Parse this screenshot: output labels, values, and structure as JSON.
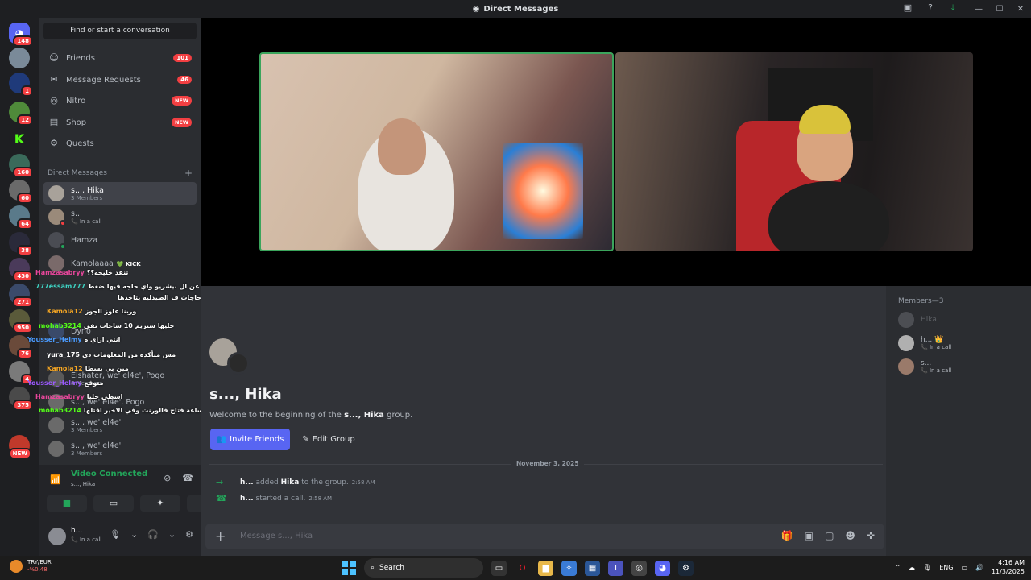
{
  "window": {
    "title": "Direct Messages",
    "controls": [
      "—",
      "☐",
      "✕"
    ]
  },
  "servers": [
    {
      "badge": "148"
    },
    {
      "badge": ""
    },
    {
      "badge": "1"
    },
    {
      "badge": "12"
    },
    {
      "badge": ""
    },
    {
      "badge": "160"
    },
    {
      "badge": "60"
    },
    {
      "badge": "64"
    },
    {
      "badge": "38"
    },
    {
      "badge": "430"
    },
    {
      "badge": "271"
    },
    {
      "badge": "950"
    },
    {
      "badge": "76"
    },
    {
      "badge": "4"
    },
    {
      "badge": "375"
    },
    {
      "badge": "NEW"
    }
  ],
  "sidebar": {
    "find_button": "Find or start a conversation",
    "nav": [
      {
        "label": "Friends",
        "icon": "friends-icon",
        "count": "101"
      },
      {
        "label": "Message Requests",
        "icon": "mail-icon",
        "count": "46"
      },
      {
        "label": "Nitro",
        "icon": "nitro-icon",
        "new": "NEW"
      },
      {
        "label": "Shop",
        "icon": "shop-icon",
        "new": "NEW"
      },
      {
        "label": "Quests",
        "icon": "quests-icon"
      }
    ],
    "dm_header": "Direct Messages",
    "dms": [
      {
        "name": "s..., Hika",
        "sub": "3 Members"
      },
      {
        "name": "s...",
        "sub": "In a call"
      },
      {
        "name": "Hamza",
        "sub": ""
      },
      {
        "name": "Kamolaaaa",
        "sub": "",
        "badge": "KICK"
      },
      {
        "name": "Dyno",
        "sub": ""
      },
      {
        "name": "Elshater, we' el4e', Pogo",
        "sub": "4 Members"
      },
      {
        "name": "s..., we' el4e', Pogo",
        "sub": ""
      },
      {
        "name": "s..., we' el4e'",
        "sub": "3 Members"
      },
      {
        "name": "s..., we' el4e'",
        "sub": "3 Members"
      }
    ]
  },
  "chat_overlay": [
    {
      "user": "Hamzasabryy",
      "msg": "تنفذ خليجه؟؟",
      "color": "#e8469b"
    },
    {
      "user": "777essam777",
      "msg": "لو عايز تبطل بجد العب رياضه وابعد عن ال بيشريو واي حاجه فيها ضغط",
      "color": "#3ed4c4"
    },
    {
      "user": "",
      "msg": "وف حاجات ف الصيدليه بتاخدها",
      "color": "#ffffff"
    },
    {
      "user": "Kamola12",
      "msg": "وربنا عاوز الجوز",
      "color": "#f5a623"
    },
    {
      "user": "mohab3214",
      "msg": "خليها ستريم 10 ساعات بقي",
      "color": "#53fc18"
    },
    {
      "user": "Yousser_Helmy",
      "msg": "انتي ازاي ه",
      "color": "#4a9bff"
    },
    {
      "user": "yura_175",
      "msg": "مش متأكده من المعلومات دي",
      "color": "#ffffff"
    },
    {
      "user": "Kamola12",
      "msg": "مين بي يسطا",
      "color": "#f5a623"
    },
    {
      "user": "Yousser_Helmy",
      "msg": "متوقع",
      "color": "#9b59ff"
    },
    {
      "user": "Hamzasabryy",
      "msg": "اسطى خليا",
      "color": "#e8469b"
    },
    {
      "user": "mohab3214",
      "msg": "بقولك يعد اخر ساعة فتاح فالورنت وفي الاخير اقتلها",
      "color": "#53fc18"
    }
  ],
  "voice": {
    "status": "Video Connected",
    "channel": "s..., Hika"
  },
  "user": {
    "name": "h...",
    "status": "In a call"
  },
  "group": {
    "title": "s..., Hika",
    "welcome_prefix": "Welcome to the beginning of the",
    "welcome_name": "s..., Hika",
    "welcome_suffix": "group.",
    "invite_label": "Invite Friends",
    "edit_label": "Edit Group"
  },
  "messages": {
    "date_divider": "November 3, 2025",
    "items": [
      {
        "actor": "h...",
        "text1": "added",
        "target": "Hika",
        "text2": "to the group.",
        "time": "2:58 AM",
        "icon": "arrow-right-icon"
      },
      {
        "actor": "h...",
        "text1": "started a call.",
        "target": "",
        "text2": "",
        "time": "2:58 AM",
        "icon": "phone-icon"
      }
    ]
  },
  "composer": {
    "placeholder": "Message s..., Hika"
  },
  "members": {
    "header": "Members—3",
    "list": [
      {
        "name": "Hika",
        "status": ""
      },
      {
        "name": "h... 👑",
        "status": "In a call"
      },
      {
        "name": "s...",
        "status": "In a call"
      }
    ]
  },
  "taskbar": {
    "weather_title": "TRY/EUR",
    "weather_value": "-%0,48",
    "search_label": "Search",
    "lang": "ENG",
    "time": "4:16 AM",
    "date": "11/3/2025"
  }
}
